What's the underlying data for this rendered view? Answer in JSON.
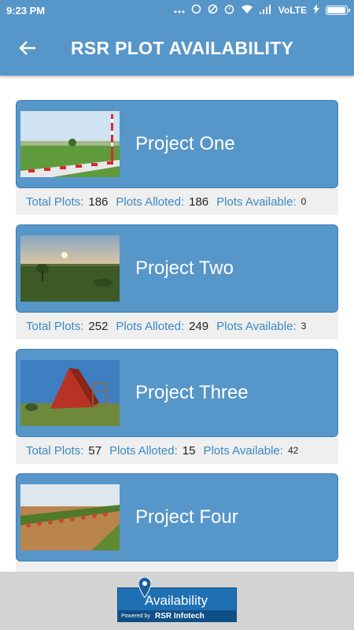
{
  "status_bar": {
    "time": "9:23 PM",
    "carrier": "VoLTE",
    "battery_level": 0.95
  },
  "header": {
    "title": "RSR PLOT AVAILABILITY",
    "back_icon": "arrow-left-icon"
  },
  "projects": [
    {
      "name": "Project One",
      "total_label": "Total Plots:",
      "total": "186",
      "alloted_label": "Plots Alloted:",
      "alloted": "186",
      "available_label": "Plots Available:",
      "available": "0"
    },
    {
      "name": "Project Two",
      "total_label": "Total Plots:",
      "total": "252",
      "alloted_label": "Plots Alloted:",
      "alloted": "249",
      "available_label": "Plots Available:",
      "available": "3"
    },
    {
      "name": "Project Three",
      "total_label": "Total Plots:",
      "total": "57",
      "alloted_label": "Plots Alloted:",
      "alloted": "15",
      "available_label": "Plots Available:",
      "available": "42"
    },
    {
      "name": "Project Four",
      "total_label": "",
      "total": "",
      "alloted_label": "",
      "alloted": "",
      "available_label": "",
      "available": ""
    }
  ],
  "footer": {
    "logo_title": "Availability",
    "powered_by": "Powered by",
    "brand": "RSR Infotech"
  },
  "colors": {
    "primary": "#5796c9",
    "label_blue": "#3a89c4",
    "stats_bg": "#efefef",
    "footer_bg": "#d3d3d3"
  }
}
